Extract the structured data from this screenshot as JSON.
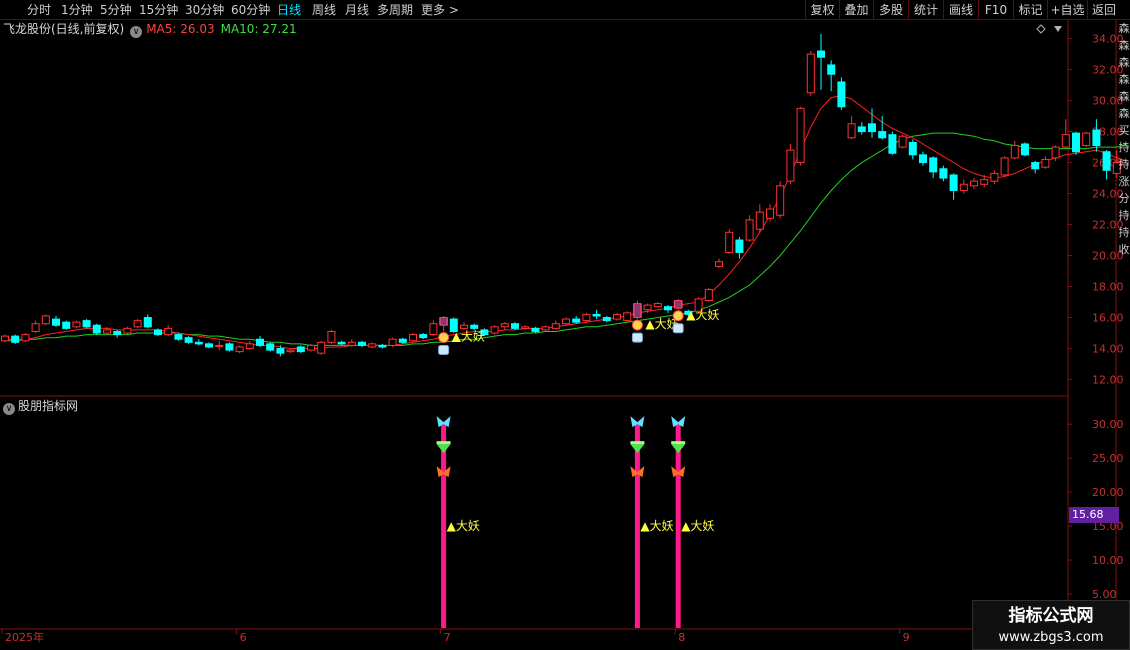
{
  "toolbar": {
    "periods": [
      {
        "label": "分时",
        "active": false
      },
      {
        "label": "1分钟",
        "active": false
      },
      {
        "label": "5分钟",
        "active": false
      },
      {
        "label": "15分钟",
        "active": false
      },
      {
        "label": "30分钟",
        "active": false
      },
      {
        "label": "60分钟",
        "active": false
      },
      {
        "label": "日线",
        "active": true
      },
      {
        "label": "周线",
        "active": false
      },
      {
        "label": "月线",
        "active": false
      },
      {
        "label": "多周期",
        "active": false
      },
      {
        "label": "更多 >",
        "active": false
      }
    ],
    "tools": [
      "复权",
      "叠加",
      "多股",
      "统计",
      "画线",
      "F10",
      "标记",
      "+自选",
      "返回"
    ]
  },
  "main_chart": {
    "stock_name": "飞龙股份(日线,前复权)",
    "ma5_label": "MA5: 26.03",
    "ma10_label": "MA10: 27.21"
  },
  "sub_chart": {
    "indicator_name": "股朋指标网",
    "current_value": "15.68"
  },
  "side_strip_text": "森森森森森森买持持涨分持持收",
  "watermark": {
    "title": "指标公式网",
    "url": "www.zbgs3.com"
  },
  "colors": {
    "up": "#ff3030",
    "down": "#00ffff",
    "ma5": "#ff2020",
    "ma10": "#20d020",
    "axis": "#8a1010",
    "signal_bar": "#ff1a8c",
    "signal_text": "#ffff40"
  },
  "chart_data": {
    "type": "candlestick",
    "title": "飞龙股份(日线,前复权)",
    "y_axis_labels": [
      "34.00",
      "32.00",
      "30.00",
      "28.00",
      "26.00",
      "24.00",
      "22.00",
      "20.00",
      "18.00",
      "16.00",
      "14.00",
      "12.00"
    ],
    "y_range": [
      11.0,
      35.2
    ],
    "x_axis_labels": [
      {
        "label": "2025年",
        "index": 0
      },
      {
        "label": "6",
        "index": 23
      },
      {
        "label": "7",
        "index": 43
      },
      {
        "label": "8",
        "index": 66
      },
      {
        "label": "9",
        "index": 88
      }
    ],
    "candles": [
      {
        "o": 14.5,
        "c": 14.8,
        "h": 14.9,
        "l": 14.4
      },
      {
        "o": 14.8,
        "c": 14.4,
        "h": 14.9,
        "l": 14.3
      },
      {
        "o": 14.5,
        "c": 14.9,
        "h": 15.0,
        "l": 14.4
      },
      {
        "o": 15.1,
        "c": 15.6,
        "h": 15.8,
        "l": 15.0
      },
      {
        "o": 15.6,
        "c": 16.1,
        "h": 16.2,
        "l": 15.5
      },
      {
        "o": 15.9,
        "c": 15.5,
        "h": 16.1,
        "l": 15.4
      },
      {
        "o": 15.7,
        "c": 15.3,
        "h": 15.8,
        "l": 15.2
      },
      {
        "o": 15.4,
        "c": 15.7,
        "h": 15.8,
        "l": 15.3
      },
      {
        "o": 15.8,
        "c": 15.4,
        "h": 15.9,
        "l": 15.3
      },
      {
        "o": 15.5,
        "c": 15.0,
        "h": 15.6,
        "l": 14.9
      },
      {
        "o": 15.0,
        "c": 15.2,
        "h": 15.4,
        "l": 14.9
      },
      {
        "o": 15.1,
        "c": 14.9,
        "h": 15.2,
        "l": 14.7
      },
      {
        "o": 15.0,
        "c": 15.3,
        "h": 15.4,
        "l": 14.9
      },
      {
        "o": 15.4,
        "c": 15.8,
        "h": 15.9,
        "l": 15.3
      },
      {
        "o": 16.0,
        "c": 15.4,
        "h": 16.2,
        "l": 15.3
      },
      {
        "o": 15.2,
        "c": 14.9,
        "h": 15.3,
        "l": 14.8
      },
      {
        "o": 14.9,
        "c": 15.3,
        "h": 15.5,
        "l": 14.8
      },
      {
        "o": 14.9,
        "c": 14.6,
        "h": 15.0,
        "l": 14.5
      },
      {
        "o": 14.7,
        "c": 14.4,
        "h": 14.8,
        "l": 14.3
      },
      {
        "o": 14.4,
        "c": 14.3,
        "h": 14.6,
        "l": 14.2
      },
      {
        "o": 14.3,
        "c": 14.1,
        "h": 14.4,
        "l": 14.0
      },
      {
        "o": 14.2,
        "c": 14.2,
        "h": 14.5,
        "l": 13.9
      },
      {
        "o": 14.3,
        "c": 13.9,
        "h": 14.4,
        "l": 13.8
      },
      {
        "o": 13.8,
        "c": 14.1,
        "h": 14.2,
        "l": 13.7
      },
      {
        "o": 14.0,
        "c": 14.3,
        "h": 14.5,
        "l": 13.9
      },
      {
        "o": 14.6,
        "c": 14.2,
        "h": 14.8,
        "l": 14.1
      },
      {
        "o": 14.3,
        "c": 13.9,
        "h": 14.4,
        "l": 13.8
      },
      {
        "o": 14.0,
        "c": 13.7,
        "h": 14.2,
        "l": 13.5
      },
      {
        "o": 13.8,
        "c": 13.9,
        "h": 14.0,
        "l": 13.7
      },
      {
        "o": 14.1,
        "c": 13.8,
        "h": 14.2,
        "l": 13.7
      },
      {
        "o": 13.9,
        "c": 14.2,
        "h": 14.3,
        "l": 13.8
      },
      {
        "o": 13.7,
        "c": 14.4,
        "h": 14.5,
        "l": 13.6
      },
      {
        "o": 14.4,
        "c": 15.1,
        "h": 15.2,
        "l": 14.3
      },
      {
        "o": 14.4,
        "c": 14.3,
        "h": 14.5,
        "l": 14.2
      },
      {
        "o": 14.2,
        "c": 14.4,
        "h": 14.6,
        "l": 14.1
      },
      {
        "o": 14.4,
        "c": 14.2,
        "h": 14.5,
        "l": 14.1
      },
      {
        "o": 14.1,
        "c": 14.3,
        "h": 14.4,
        "l": 14.0
      },
      {
        "o": 14.2,
        "c": 14.1,
        "h": 14.3,
        "l": 14.0
      },
      {
        "o": 14.2,
        "c": 14.6,
        "h": 14.7,
        "l": 14.1
      },
      {
        "o": 14.6,
        "c": 14.4,
        "h": 14.7,
        "l": 14.3
      },
      {
        "o": 14.5,
        "c": 14.9,
        "h": 15.0,
        "l": 14.4
      },
      {
        "o": 14.9,
        "c": 14.7,
        "h": 15.0,
        "l": 14.6
      },
      {
        "o": 14.9,
        "c": 15.6,
        "h": 15.8,
        "l": 14.8
      },
      {
        "o": 15.5,
        "c": 16.0,
        "h": 16.1,
        "l": 15.1
      },
      {
        "o": 15.9,
        "c": 15.1,
        "h": 16.0,
        "l": 15.0
      },
      {
        "o": 15.3,
        "c": 15.5,
        "h": 15.7,
        "l": 15.2
      },
      {
        "o": 15.5,
        "c": 15.3,
        "h": 15.6,
        "l": 15.2
      },
      {
        "o": 15.2,
        "c": 14.9,
        "h": 15.3,
        "l": 14.8
      },
      {
        "o": 15.0,
        "c": 15.4,
        "h": 15.5,
        "l": 14.9
      },
      {
        "o": 15.4,
        "c": 15.6,
        "h": 15.7,
        "l": 15.2
      },
      {
        "o": 15.6,
        "c": 15.3,
        "h": 15.7,
        "l": 15.2
      },
      {
        "o": 15.3,
        "c": 15.4,
        "h": 15.5,
        "l": 15.2
      },
      {
        "o": 15.3,
        "c": 15.1,
        "h": 15.4,
        "l": 15.0
      },
      {
        "o": 15.2,
        "c": 15.4,
        "h": 15.5,
        "l": 15.1
      },
      {
        "o": 15.3,
        "c": 15.6,
        "h": 15.8,
        "l": 15.2
      },
      {
        "o": 15.6,
        "c": 15.9,
        "h": 16.0,
        "l": 15.5
      },
      {
        "o": 15.9,
        "c": 15.7,
        "h": 16.1,
        "l": 15.6
      },
      {
        "o": 15.8,
        "c": 16.2,
        "h": 16.3,
        "l": 15.7
      },
      {
        "o": 16.2,
        "c": 16.1,
        "h": 16.5,
        "l": 15.9
      },
      {
        "o": 16.0,
        "c": 15.8,
        "h": 16.1,
        "l": 15.7
      },
      {
        "o": 15.9,
        "c": 16.2,
        "h": 16.3,
        "l": 15.8
      },
      {
        "o": 15.8,
        "c": 16.3,
        "h": 16.4,
        "l": 15.7
      },
      {
        "o": 16.0,
        "c": 16.9,
        "h": 17.1,
        "l": 15.9
      },
      {
        "o": 16.5,
        "c": 16.8,
        "h": 16.9,
        "l": 16.3
      },
      {
        "o": 16.7,
        "c": 16.9,
        "h": 17.0,
        "l": 16.6
      },
      {
        "o": 16.7,
        "c": 16.5,
        "h": 16.8,
        "l": 16.3
      },
      {
        "o": 16.6,
        "c": 17.1,
        "h": 17.2,
        "l": 16.5
      },
      {
        "o": 16.4,
        "c": 16.2,
        "h": 16.5,
        "l": 16.1
      },
      {
        "o": 16.4,
        "c": 17.2,
        "h": 17.3,
        "l": 16.3
      },
      {
        "o": 17.1,
        "c": 17.8,
        "h": 17.9,
        "l": 17.0
      },
      {
        "o": 19.3,
        "c": 19.6,
        "h": 19.8,
        "l": 19.2
      },
      {
        "o": 20.2,
        "c": 21.5,
        "h": 21.7,
        "l": 20.1
      },
      {
        "o": 21.0,
        "c": 20.2,
        "h": 21.2,
        "l": 19.8
      },
      {
        "o": 21.0,
        "c": 22.3,
        "h": 22.6,
        "l": 20.9
      },
      {
        "o": 21.7,
        "c": 22.8,
        "h": 23.3,
        "l": 21.5
      },
      {
        "o": 22.4,
        "c": 23.0,
        "h": 23.3,
        "l": 22.2
      },
      {
        "o": 22.6,
        "c": 24.5,
        "h": 24.8,
        "l": 22.4
      },
      {
        "o": 24.8,
        "c": 26.8,
        "h": 27.2,
        "l": 24.6
      },
      {
        "o": 26.0,
        "c": 29.5,
        "h": 29.6,
        "l": 25.8
      },
      {
        "o": 30.5,
        "c": 33.0,
        "h": 33.2,
        "l": 30.3
      },
      {
        "o": 33.2,
        "c": 32.8,
        "h": 34.3,
        "l": 30.7
      },
      {
        "o": 32.3,
        "c": 31.7,
        "h": 32.6,
        "l": 30.6
      },
      {
        "o": 31.2,
        "c": 29.6,
        "h": 31.5,
        "l": 29.4
      },
      {
        "o": 27.6,
        "c": 28.5,
        "h": 29.0,
        "l": 27.5
      },
      {
        "o": 28.3,
        "c": 28.0,
        "h": 28.6,
        "l": 27.8
      },
      {
        "o": 28.5,
        "c": 28.0,
        "h": 29.5,
        "l": 27.6
      },
      {
        "o": 28.0,
        "c": 27.6,
        "h": 29.0,
        "l": 27.5
      },
      {
        "o": 27.8,
        "c": 26.6,
        "h": 28.0,
        "l": 26.5
      },
      {
        "o": 27.0,
        "c": 27.7,
        "h": 27.8,
        "l": 26.9
      },
      {
        "o": 27.3,
        "c": 26.5,
        "h": 27.5,
        "l": 26.2
      },
      {
        "o": 26.5,
        "c": 26.0,
        "h": 26.7,
        "l": 25.8
      },
      {
        "o": 26.3,
        "c": 25.4,
        "h": 26.4,
        "l": 25.0
      },
      {
        "o": 25.6,
        "c": 25.0,
        "h": 25.8,
        "l": 24.8
      },
      {
        "o": 25.2,
        "c": 24.2,
        "h": 25.3,
        "l": 23.6
      },
      {
        "o": 24.2,
        "c": 24.6,
        "h": 24.9,
        "l": 24.0
      },
      {
        "o": 24.5,
        "c": 24.8,
        "h": 25.0,
        "l": 24.3
      },
      {
        "o": 24.6,
        "c": 24.9,
        "h": 25.2,
        "l": 24.4
      },
      {
        "o": 24.8,
        "c": 25.3,
        "h": 25.5,
        "l": 24.6
      },
      {
        "o": 25.2,
        "c": 26.3,
        "h": 26.4,
        "l": 25.1
      },
      {
        "o": 26.3,
        "c": 27.1,
        "h": 27.4,
        "l": 26.2
      },
      {
        "o": 27.2,
        "c": 26.5,
        "h": 27.3,
        "l": 26.4
      },
      {
        "o": 26.0,
        "c": 25.6,
        "h": 26.1,
        "l": 25.3
      },
      {
        "o": 25.7,
        "c": 26.2,
        "h": 26.4,
        "l": 25.6
      },
      {
        "o": 26.3,
        "c": 27.0,
        "h": 27.1,
        "l": 26.1
      },
      {
        "o": 27.0,
        "c": 27.8,
        "h": 28.8,
        "l": 26.9
      },
      {
        "o": 27.9,
        "c": 26.7,
        "h": 28.0,
        "l": 26.5
      },
      {
        "o": 27.1,
        "c": 27.9,
        "h": 28.0,
        "l": 27.0
      },
      {
        "o": 28.1,
        "c": 27.1,
        "h": 28.8,
        "l": 26.7
      },
      {
        "o": 26.7,
        "c": 25.5,
        "h": 26.8,
        "l": 24.9
      },
      {
        "o": 25.3,
        "c": 26.0,
        "h": 26.8,
        "l": 25.0
      }
    ],
    "ma5": [
      14.6,
      14.6,
      14.6,
      14.7,
      14.9,
      15.0,
      15.1,
      15.2,
      15.3,
      15.3,
      15.3,
      15.2,
      15.2,
      15.2,
      15.2,
      15.2,
      15.1,
      15.0,
      14.9,
      14.8,
      14.7,
      14.6,
      14.5,
      14.4,
      14.3,
      14.2,
      14.2,
      14.1,
      14.0,
      14.0,
      14.0,
      14.0,
      14.1,
      14.1,
      14.2,
      14.2,
      14.2,
      14.2,
      14.2,
      14.3,
      14.4,
      14.5,
      14.6,
      14.8,
      14.9,
      15.0,
      15.1,
      15.1,
      15.1,
      15.2,
      15.2,
      15.3,
      15.3,
      15.3,
      15.4,
      15.5,
      15.6,
      15.7,
      15.8,
      15.9,
      16.0,
      16.1,
      16.3,
      16.4,
      16.5,
      16.6,
      16.8,
      16.9,
      17.0,
      17.5,
      18.1,
      18.8,
      19.6,
      20.5,
      21.5,
      22.6,
      23.8,
      25.2,
      26.8,
      28.3,
      29.5,
      30.2,
      30.3,
      30.1,
      29.6,
      29.1,
      28.6,
      28.2,
      27.9,
      27.6,
      27.2,
      26.8,
      26.4,
      26.0,
      25.6,
      25.3,
      25.1,
      25.0,
      25.1,
      25.3,
      25.6,
      25.9,
      26.1,
      26.3,
      26.5,
      26.6,
      26.7,
      26.8,
      26.6,
      26.3,
      26.1
    ],
    "ma10": [
      14.5,
      14.5,
      14.6,
      14.6,
      14.7,
      14.7,
      14.8,
      14.8,
      14.9,
      14.9,
      14.9,
      14.9,
      14.9,
      15.0,
      15.0,
      15.0,
      15.0,
      15.0,
      14.9,
      14.9,
      14.8,
      14.8,
      14.7,
      14.6,
      14.6,
      14.5,
      14.4,
      14.4,
      14.3,
      14.3,
      14.2,
      14.2,
      14.2,
      14.2,
      14.2,
      14.2,
      14.2,
      14.2,
      14.2,
      14.2,
      14.3,
      14.3,
      14.4,
      14.4,
      14.5,
      14.6,
      14.6,
      14.7,
      14.8,
      14.9,
      14.9,
      15.0,
      15.0,
      15.1,
      15.1,
      15.2,
      15.3,
      15.4,
      15.4,
      15.5,
      15.6,
      15.7,
      15.8,
      15.9,
      16.0,
      16.1,
      16.2,
      16.3,
      16.5,
      16.7,
      17.0,
      17.3,
      17.7,
      18.1,
      18.7,
      19.3,
      20.0,
      20.8,
      21.6,
      22.5,
      23.4,
      24.2,
      24.9,
      25.5,
      26.0,
      26.4,
      26.8,
      27.2,
      27.5,
      27.7,
      27.8,
      27.9,
      27.9,
      27.9,
      27.8,
      27.7,
      27.5,
      27.4,
      27.2,
      27.1,
      27.0,
      26.9,
      26.9,
      26.9,
      26.9,
      26.9,
      26.9,
      27.0,
      27.0,
      27.0,
      27.2
    ],
    "signals": [
      {
        "index": 43,
        "label": "大妖"
      },
      {
        "index": 62,
        "label": "大妖"
      },
      {
        "index": 66,
        "label": "大妖"
      }
    ],
    "sub_y_axis_labels": [
      "30.00",
      "25.00",
      "20.00",
      "15.00",
      "10.00",
      "5.00"
    ],
    "sub_y_range": [
      0,
      34
    ],
    "signal_bar_top_value": 30.0
  }
}
